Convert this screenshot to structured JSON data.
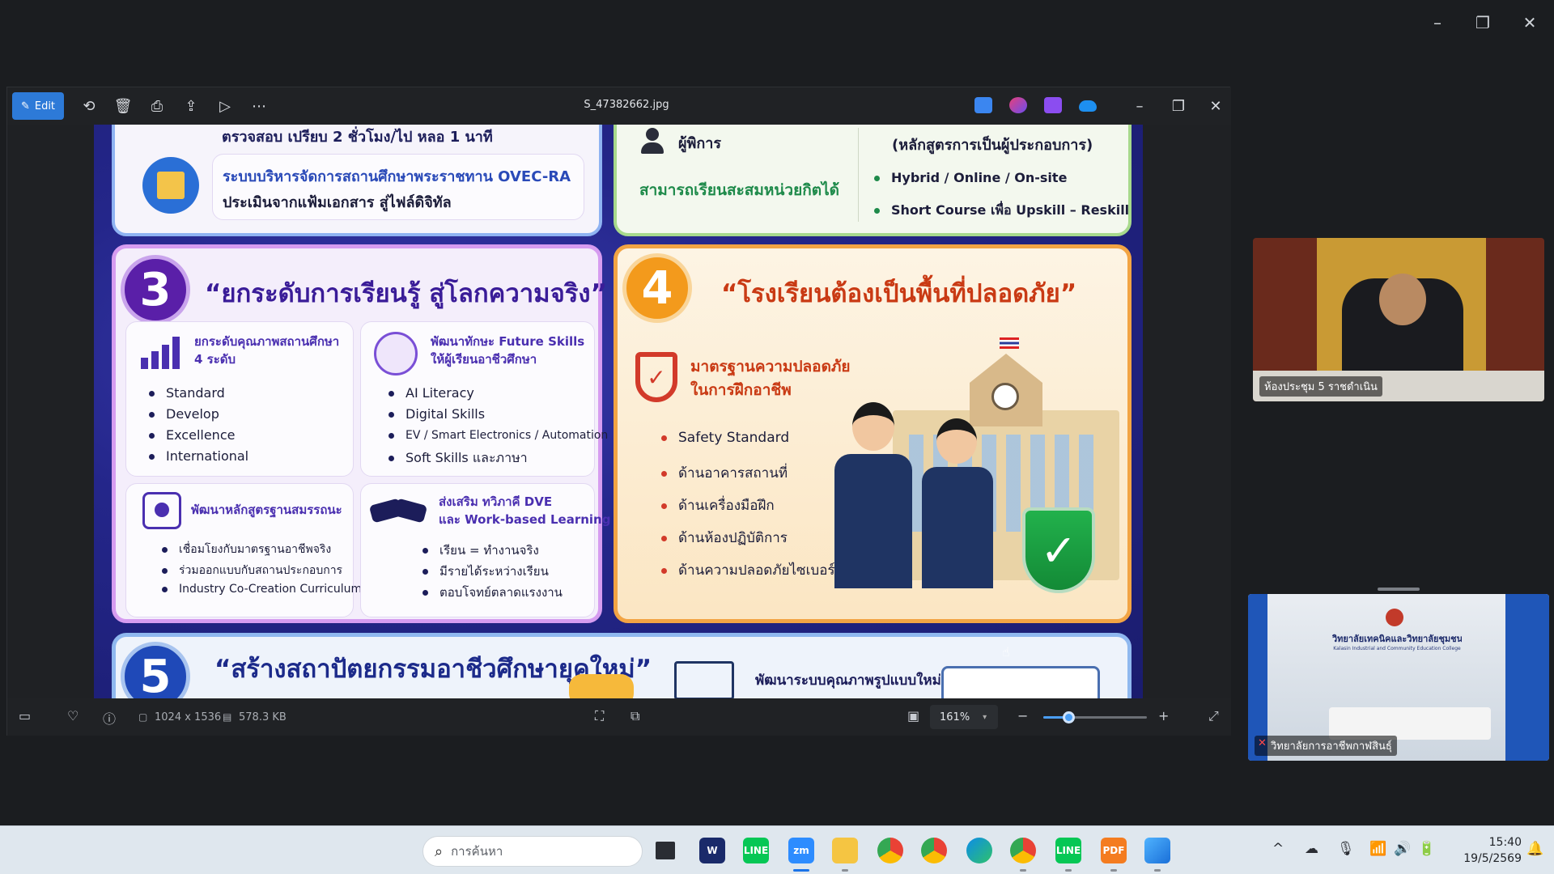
{
  "viewer": {
    "edit_label": "Edit",
    "file_name": "S_47382662.jpg",
    "dimensions": "1024 x 1536",
    "file_size": "578.3 KB",
    "zoom": "161%",
    "zoom_fraction": 0.24
  },
  "poster": {
    "top_left": {
      "line_partial": "ตรวจสอบ เปรียบ 2 ชั่วโมง/ไป หลอ 1 นาที",
      "item_title": "ระบบบริหารจัดการสถานศึกษาพระราชทาน OVEC-RA",
      "item_desc": "ประเมินจากแฟ้มเอกสาร สู่ไฟล์ดิจิทัล"
    },
    "top_right": {
      "person": "ผู้พิการ",
      "credit": "สามารถเรียนสะสมหน่วยกิตได้",
      "course_note": "(หลักสูตรการเป็นผู้ประกอบการ)",
      "bullets": [
        "Hybrid / Online / On-site",
        "Short Course เพื่อ Upskill – Reskill"
      ]
    },
    "sec3": {
      "num": "3",
      "title": "“ยกระดับการเรียนรู้ สู่โลกความจริง”",
      "cards": [
        {
          "head": "ยกระดับคุณภาพสถานศึกษา\n4 ระดับ",
          "items": [
            "Standard",
            "Develop",
            "Excellence",
            "International"
          ]
        },
        {
          "head": "พัฒนาทักษะ Future Skills\nให้ผู้เรียนอาชีวศึกษา",
          "items": [
            "AI Literacy",
            "Digital Skills",
            "EV / Smart Electronics / Automation",
            "Soft Skills และภาษา"
          ]
        },
        {
          "head": "พัฒนาหลักสูตรฐานสมรรถนะ",
          "items": [
            "เชื่อมโยงกับมาตรฐานอาชีพจริง",
            "ร่วมออกแบบกับสถานประกอบการ",
            "Industry Co-Creation Curriculum"
          ]
        },
        {
          "head": "ส่งเสริม ทวิภาคี DVE\nและ Work-based Learning",
          "items": [
            "เรียน = ทำงานจริง",
            "มีรายได้ระหว่างเรียน",
            "ตอบโจทย์ตลาดแรงงาน"
          ]
        }
      ]
    },
    "sec4": {
      "num": "4",
      "title": "“โรงเรียนต้องเป็นพื้นที่ปลอดภัย”",
      "head": "มาตรฐานความปลอดภัย\nในการฝึกอาชีพ",
      "items": [
        "Safety Standard",
        "ด้านอาคารสถานที่",
        "ด้านเครื่องมือฝึก",
        "ด้านห้องปฏิบัติการ",
        "ด้านความปลอดภัยไซเบอร์"
      ]
    },
    "sec5": {
      "num": "5",
      "title": "“สร้างสถาปัตยกรรมอาชีวศึกษายุคใหม่”",
      "right_text": "พัฒนาระบบคุณภาพรูปแบบใหม่"
    }
  },
  "zoom_tiles": [
    {
      "label": "ห้องประชุม 5 ราชดำเนิน"
    },
    {
      "label": "วิทยาลัยการอาชีพกาฬสินธุ์",
      "banner": "วิทยาลัยเทคนิคและวิทยาลัยชุมชน",
      "banner_sub": "Kalasin Industrial and Community Education College"
    }
  ],
  "taskbar": {
    "search_placeholder": "การค้นหา",
    "time": "15:40",
    "date": "19/5/2569",
    "icons": [
      "windows-start",
      "task-view",
      "webex",
      "line",
      "zoom",
      "file-explorer",
      "chrome",
      "chrome-2",
      "edge",
      "chrome-3",
      "line-2",
      "pdf",
      "photos"
    ],
    "colors": {
      "line": "#06c755",
      "zoom": "#2d8cff",
      "chrome": "#e94235",
      "edge": "#0c8ce9"
    }
  }
}
